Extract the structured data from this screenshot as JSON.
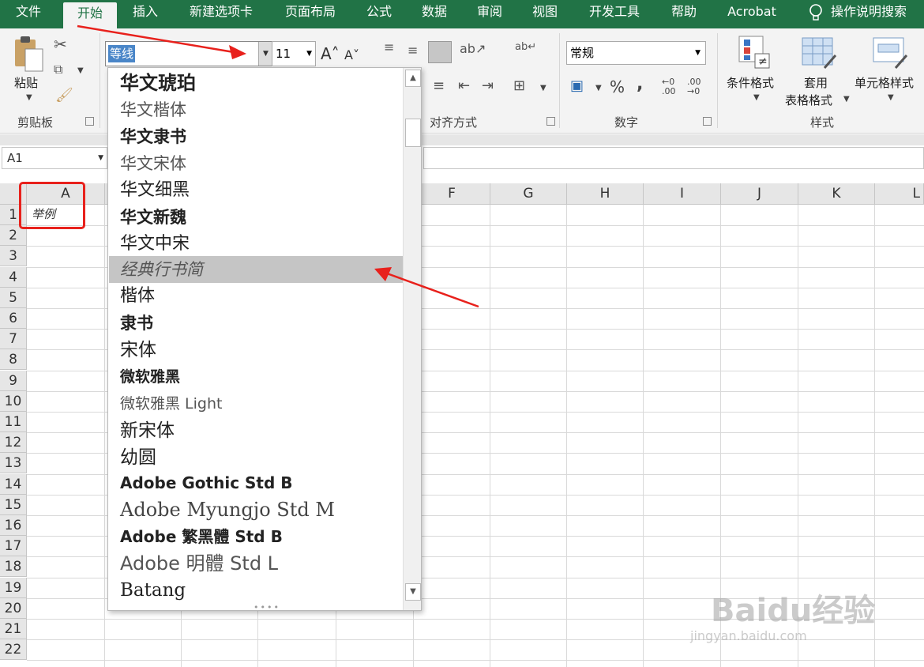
{
  "tabs": [
    {
      "label": "文件"
    },
    {
      "label": "开始"
    },
    {
      "label": "插入"
    },
    {
      "label": "新建选项卡"
    },
    {
      "label": "页面布局"
    },
    {
      "label": "公式"
    },
    {
      "label": "数据"
    },
    {
      "label": "审阅"
    },
    {
      "label": "视图"
    },
    {
      "label": "开发工具"
    },
    {
      "label": "帮助"
    },
    {
      "label": "Acrobat"
    }
  ],
  "tell_me": "操作说明搜索",
  "ribbon": {
    "paste_label": "粘贴",
    "clipboard_group": "剪贴板",
    "font_name": "等线",
    "font_size": "11",
    "alignment_group": "对齐方式",
    "number_format": "常规",
    "number_group": "数字",
    "conditional_format": "条件格式",
    "table_format_1": "套用",
    "table_format_2": "表格格式",
    "cell_styles": "单元格样式",
    "styles_group": "样式",
    "percent": "%",
    "comma": ",",
    "inc_decimal": "←0 .00",
    "dec_decimal": ".00 →0"
  },
  "name_box": "A1",
  "columns": [
    "A",
    "F",
    "G",
    "H",
    "I",
    "J",
    "K",
    "L"
  ],
  "rows": [
    "1",
    "2",
    "3",
    "4",
    "5",
    "6",
    "7",
    "8",
    "9",
    "10",
    "11",
    "12",
    "13",
    "14",
    "15",
    "16",
    "17",
    "18",
    "19",
    "20",
    "21",
    "22"
  ],
  "cell_a1": "举例",
  "font_list": [
    "华文琥珀",
    "华文楷体",
    "华文隶书",
    "华文宋体",
    "华文细黑",
    "华文新魏",
    "华文中宋",
    "经典行书简",
    "楷体",
    "隶书",
    "宋体",
    "微软雅黑",
    "微软雅黑 Light",
    "新宋体",
    "幼圆",
    "Adobe Gothic Std B",
    "Adobe Myungjo Std M",
    "Adobe 繁黑體 Std B",
    "Adobe 明體 Std L",
    "Batang"
  ],
  "highlighted_font": "经典行书简",
  "watermark": {
    "text": "Baidu经验",
    "url": "jingyan.baidu.com"
  },
  "colors": {
    "ribbon_green": "#217346",
    "highlight": "#c5c5c5",
    "annotation_red": "#e8211c"
  }
}
